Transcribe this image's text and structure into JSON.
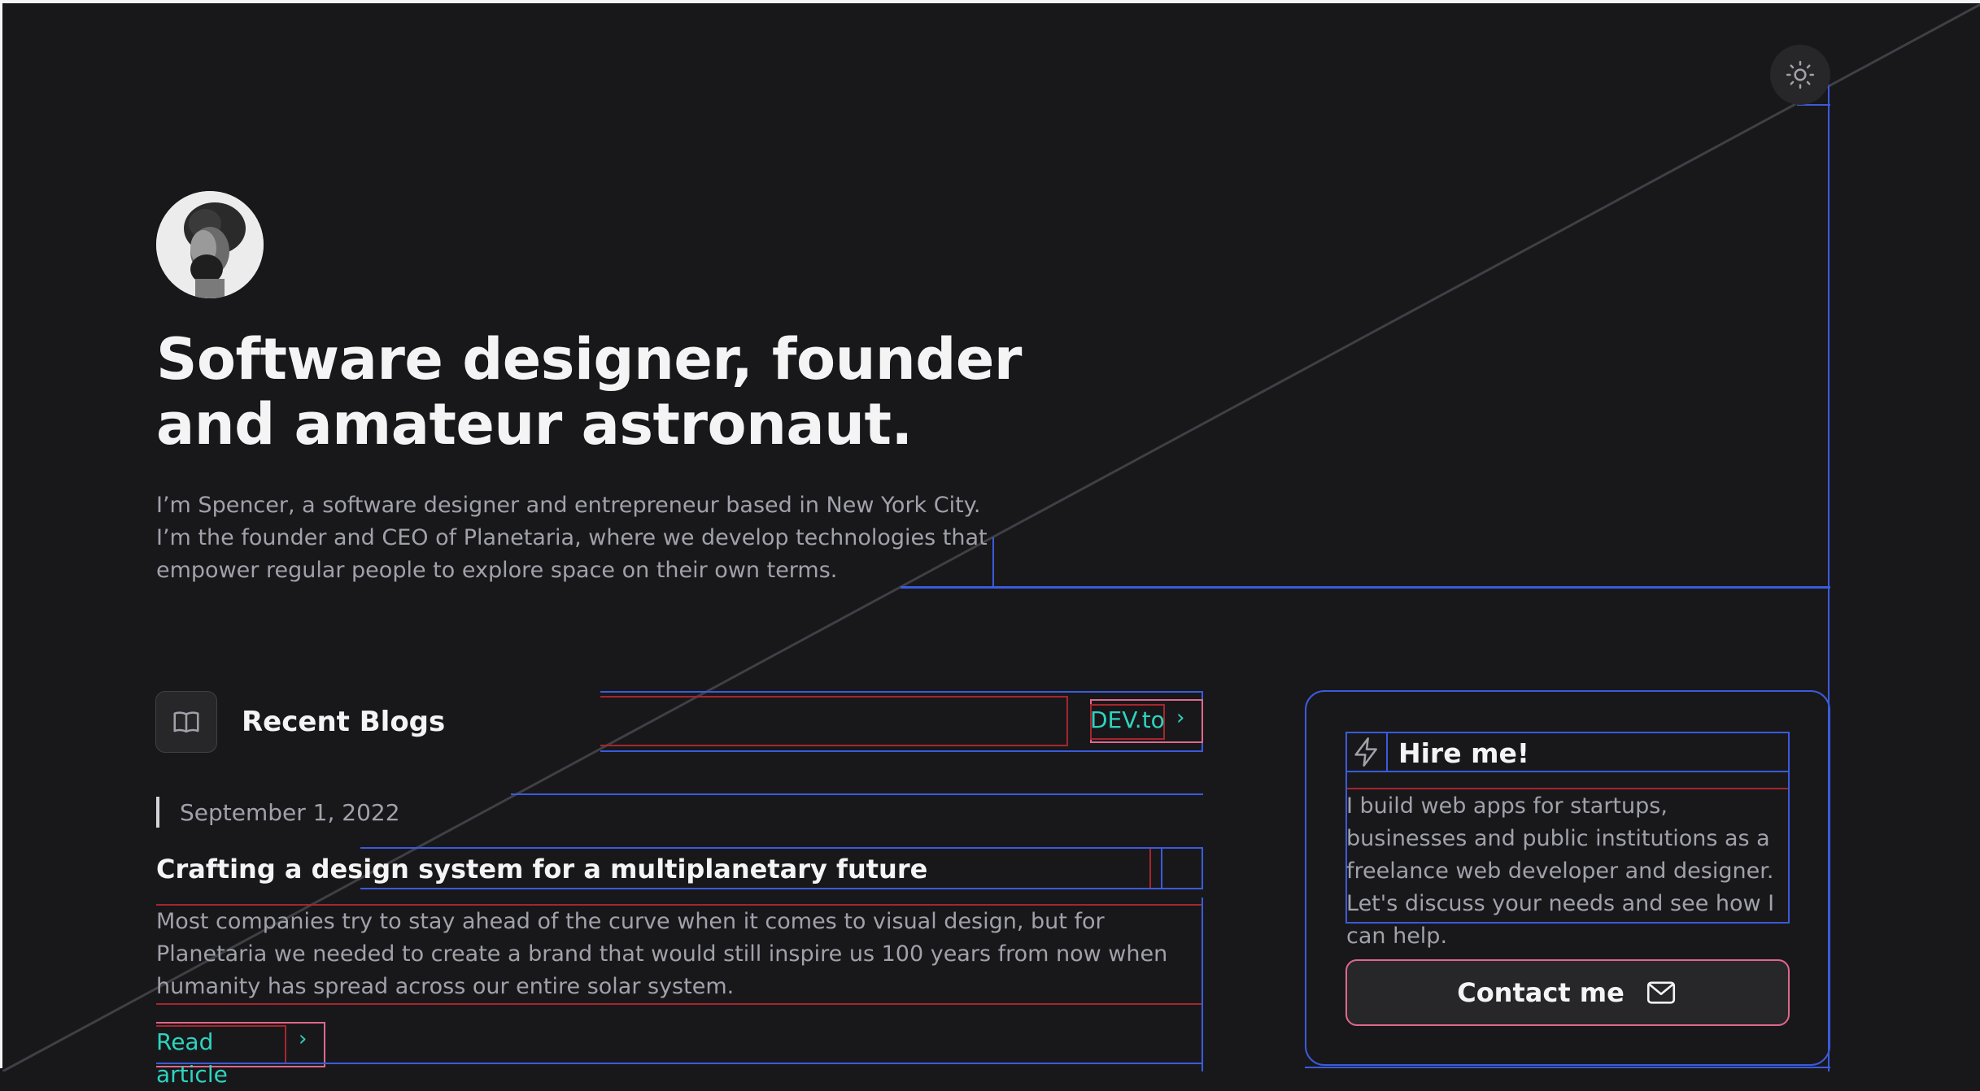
{
  "hero": {
    "title": "Software designer, founder\nand amateur astronaut.",
    "bio": "I’m Spencer, a software designer and entrepreneur based in New York City. I’m the founder and CEO of Planetaria, where we develop technologies that empower regular people to explore space on their own terms."
  },
  "blogs": {
    "title": "Recent Blogs",
    "source_link": "DEV.to",
    "icon": "book-icon",
    "posts": [
      {
        "date": "September 1, 2022",
        "title": "Crafting a design system for a multiplanetary future",
        "excerpt": "Most companies try to stay ahead of the curve when it comes to visual design, but for Planetaria we needed to create a brand that would still inspire us 100 years from now when humanity has spread across our entire solar system.",
        "cta": "Read article"
      }
    ]
  },
  "hire": {
    "title": "Hire me!",
    "icon": "lightning-icon",
    "description": "I build web apps for startups, businesses and public institutions as a freelance web developer and designer. Let's discuss your needs and see how I can help.",
    "button_label": "Contact me",
    "button_icon": "mail-icon"
  },
  "colors": {
    "background": "#18181b",
    "accent": "#2dd4bf",
    "text": "#f4f4f5",
    "muted": "#a1a1aa",
    "debug_blue": "#3b5bdb",
    "debug_red": "#a5262d",
    "debug_pink": "#e0688a"
  }
}
